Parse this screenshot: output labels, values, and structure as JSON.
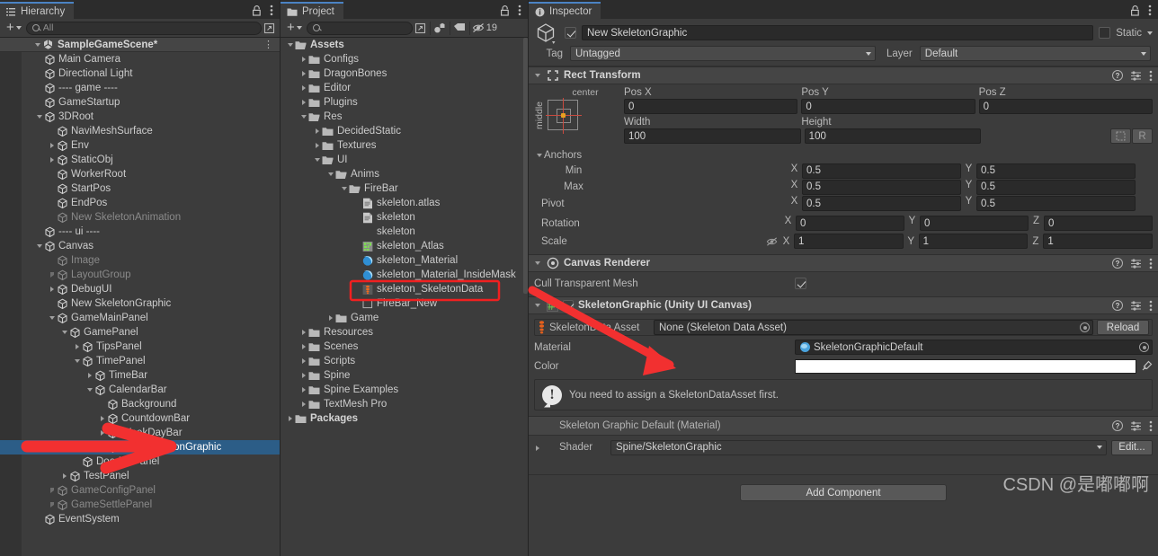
{
  "hierarchy": {
    "tab_label": "Hierarchy",
    "search_placeholder": "All",
    "scene_name": "SampleGameScene*",
    "items": [
      {
        "label": "Main Camera",
        "depth": 2,
        "tri": "none",
        "dim": false
      },
      {
        "label": "Directional Light",
        "depth": 2,
        "tri": "none",
        "dim": false
      },
      {
        "label": "---- game ----",
        "depth": 2,
        "tri": "none",
        "dim": false
      },
      {
        "label": "GameStartup",
        "depth": 2,
        "tri": "none",
        "dim": false
      },
      {
        "label": "3DRoot",
        "depth": 2,
        "tri": "open",
        "dim": false
      },
      {
        "label": "NaviMeshSurface",
        "depth": 3,
        "tri": "none",
        "dim": false
      },
      {
        "label": "Env",
        "depth": 3,
        "tri": "closed",
        "dim": false
      },
      {
        "label": "StaticObj",
        "depth": 3,
        "tri": "closed",
        "dim": false
      },
      {
        "label": "WorkerRoot",
        "depth": 3,
        "tri": "none",
        "dim": false
      },
      {
        "label": "StartPos",
        "depth": 3,
        "tri": "none",
        "dim": false
      },
      {
        "label": "EndPos",
        "depth": 3,
        "tri": "none",
        "dim": false
      },
      {
        "label": "New SkeletonAnimation",
        "depth": 3,
        "tri": "none",
        "dim": true
      },
      {
        "label": "---- ui ----",
        "depth": 2,
        "tri": "none",
        "dim": false
      },
      {
        "label": "Canvas",
        "depth": 2,
        "tri": "open",
        "dim": false
      },
      {
        "label": "Image",
        "depth": 3,
        "tri": "none",
        "dim": true
      },
      {
        "label": "LayoutGroup",
        "depth": 3,
        "tri": "closed",
        "dim": true
      },
      {
        "label": "DebugUI",
        "depth": 3,
        "tri": "closed",
        "dim": false
      },
      {
        "label": "New SkeletonGraphic",
        "depth": 3,
        "tri": "none",
        "dim": false
      },
      {
        "label": "GameMainPanel",
        "depth": 3,
        "tri": "open",
        "dim": false
      },
      {
        "label": "GamePanel",
        "depth": 4,
        "tri": "open",
        "dim": false
      },
      {
        "label": "TipsPanel",
        "depth": 5,
        "tri": "closed",
        "dim": false
      },
      {
        "label": "TimePanel",
        "depth": 5,
        "tri": "open",
        "dim": false
      },
      {
        "label": "TimeBar",
        "depth": 6,
        "tri": "closed",
        "dim": false
      },
      {
        "label": "CalendarBar",
        "depth": 6,
        "tri": "open",
        "dim": false
      },
      {
        "label": "Background",
        "depth": 7,
        "tri": "none",
        "dim": false
      },
      {
        "label": "CountdownBar",
        "depth": 7,
        "tri": "closed",
        "dim": false
      },
      {
        "label": "WeekDayBar",
        "depth": 7,
        "tri": "closed",
        "dim": false
      },
      {
        "label": "New SkeletonGraphic",
        "depth": 7,
        "tri": "none",
        "dim": false,
        "selected": true
      },
      {
        "label": "DoorHPPanel",
        "depth": 5,
        "tri": "none",
        "dim": false
      },
      {
        "label": "TestPanel",
        "depth": 4,
        "tri": "closed",
        "dim": false
      },
      {
        "label": "GameConfigPanel",
        "depth": 3,
        "tri": "closed",
        "dim": true
      },
      {
        "label": "GameSettlePanel",
        "depth": 3,
        "tri": "closed",
        "dim": true
      },
      {
        "label": "EventSystem",
        "depth": 2,
        "tri": "none",
        "dim": false
      }
    ]
  },
  "project": {
    "tab_label": "Project",
    "search_placeholder": "",
    "hidden_count": "19",
    "items": [
      {
        "label": "Assets",
        "depth": 0,
        "tri": "open",
        "icon": "folder-open",
        "bold": true
      },
      {
        "label": "Configs",
        "depth": 1,
        "tri": "closed",
        "icon": "folder"
      },
      {
        "label": "DragonBones",
        "depth": 1,
        "tri": "closed",
        "icon": "folder"
      },
      {
        "label": "Editor",
        "depth": 1,
        "tri": "closed",
        "icon": "folder"
      },
      {
        "label": "Plugins",
        "depth": 1,
        "tri": "closed",
        "icon": "folder"
      },
      {
        "label": "Res",
        "depth": 1,
        "tri": "open",
        "icon": "folder-open"
      },
      {
        "label": "DecidedStatic",
        "depth": 2,
        "tri": "closed",
        "icon": "folder"
      },
      {
        "label": "Textures",
        "depth": 2,
        "tri": "closed",
        "icon": "folder"
      },
      {
        "label": "UI",
        "depth": 2,
        "tri": "open",
        "icon": "folder-open"
      },
      {
        "label": "Anims",
        "depth": 3,
        "tri": "open",
        "icon": "folder-open"
      },
      {
        "label": "FireBar",
        "depth": 4,
        "tri": "open",
        "icon": "folder-open"
      },
      {
        "label": "skeleton.atlas",
        "depth": 5,
        "tri": "none",
        "icon": "text-file"
      },
      {
        "label": "skeleton",
        "depth": 5,
        "tri": "none",
        "icon": "text-file"
      },
      {
        "label": "skeleton",
        "depth": 5,
        "tri": "none",
        "icon": "none"
      },
      {
        "label": "skeleton_Atlas",
        "depth": 5,
        "tri": "none",
        "icon": "atlas-asset"
      },
      {
        "label": "skeleton_Material",
        "depth": 5,
        "tri": "none",
        "icon": "material-ball"
      },
      {
        "label": "skeleton_Material_InsideMask",
        "depth": 5,
        "tri": "none",
        "icon": "material-ball"
      },
      {
        "label": "skeleton_SkeletonData",
        "depth": 5,
        "tri": "none",
        "icon": "skeleton-data",
        "highlighted": true
      },
      {
        "label": "FireBar_New",
        "depth": 5,
        "tri": "none",
        "icon": "prefab-empty"
      },
      {
        "label": "Game",
        "depth": 3,
        "tri": "closed",
        "icon": "folder"
      },
      {
        "label": "Resources",
        "depth": 1,
        "tri": "closed",
        "icon": "folder"
      },
      {
        "label": "Scenes",
        "depth": 1,
        "tri": "closed",
        "icon": "folder"
      },
      {
        "label": "Scripts",
        "depth": 1,
        "tri": "closed",
        "icon": "folder"
      },
      {
        "label": "Spine",
        "depth": 1,
        "tri": "closed",
        "icon": "folder"
      },
      {
        "label": "Spine Examples",
        "depth": 1,
        "tri": "closed",
        "icon": "folder"
      },
      {
        "label": "TextMesh Pro",
        "depth": 1,
        "tri": "closed",
        "icon": "folder"
      },
      {
        "label": "Packages",
        "depth": 0,
        "tri": "closed",
        "icon": "folder",
        "bold": true
      }
    ]
  },
  "inspector": {
    "tab_label": "Inspector",
    "object_name": "New SkeletonGraphic",
    "static_label": "Static",
    "tag_label": "Tag",
    "tag_value": "Untagged",
    "layer_label": "Layer",
    "layer_value": "Default",
    "rect_transform": {
      "title": "Rect Transform",
      "anchor_preset_top": "center",
      "anchor_preset_side": "middle",
      "pos_x_label": "Pos X",
      "pos_x": "0",
      "pos_y_label": "Pos Y",
      "pos_y": "0",
      "pos_z_label": "Pos Z",
      "pos_z": "0",
      "width_label": "Width",
      "width": "100",
      "height_label": "Height",
      "height": "100",
      "blueprint_btn": "",
      "raw_btn": "R",
      "anchors_label": "Anchors",
      "min_label": "Min",
      "min_x": "0.5",
      "min_y": "0.5",
      "max_label": "Max",
      "max_x": "0.5",
      "max_y": "0.5",
      "pivot_label": "Pivot",
      "pivot_x": "0.5",
      "pivot_y": "0.5",
      "rotation_label": "Rotation",
      "rot_x": "0",
      "rot_y": "0",
      "rot_z": "0",
      "scale_label": "Scale",
      "scale_x": "1",
      "scale_y": "1",
      "scale_z": "1"
    },
    "canvas_renderer": {
      "title": "Canvas Renderer",
      "cull_label": "Cull Transparent Mesh"
    },
    "skeleton_graphic": {
      "title": "SkeletonGraphic (Unity UI Canvas)",
      "data_asset_label": "SkeletonData Asset",
      "data_asset_value": "None (Skeleton Data Asset)",
      "reload_label": "Reload",
      "material_label": "Material",
      "material_value": "SkeletonGraphicDefault",
      "color_label": "Color",
      "color_value": "#FFFFFF",
      "warning_text": "You need to assign a SkeletonDataAsset first."
    },
    "material_preview": {
      "title": "Skeleton Graphic Default (Material)",
      "shader_label": "Shader",
      "shader_value": "Spine/SkeletonGraphic",
      "edit_label": "Edit..."
    },
    "add_component_label": "Add Component"
  },
  "watermark": "CSDN @是嘟嘟啊",
  "colors": {
    "selection_blue": "#2c5d87",
    "annotation_red": "#f02020",
    "tab_accent": "#4b83c4"
  }
}
